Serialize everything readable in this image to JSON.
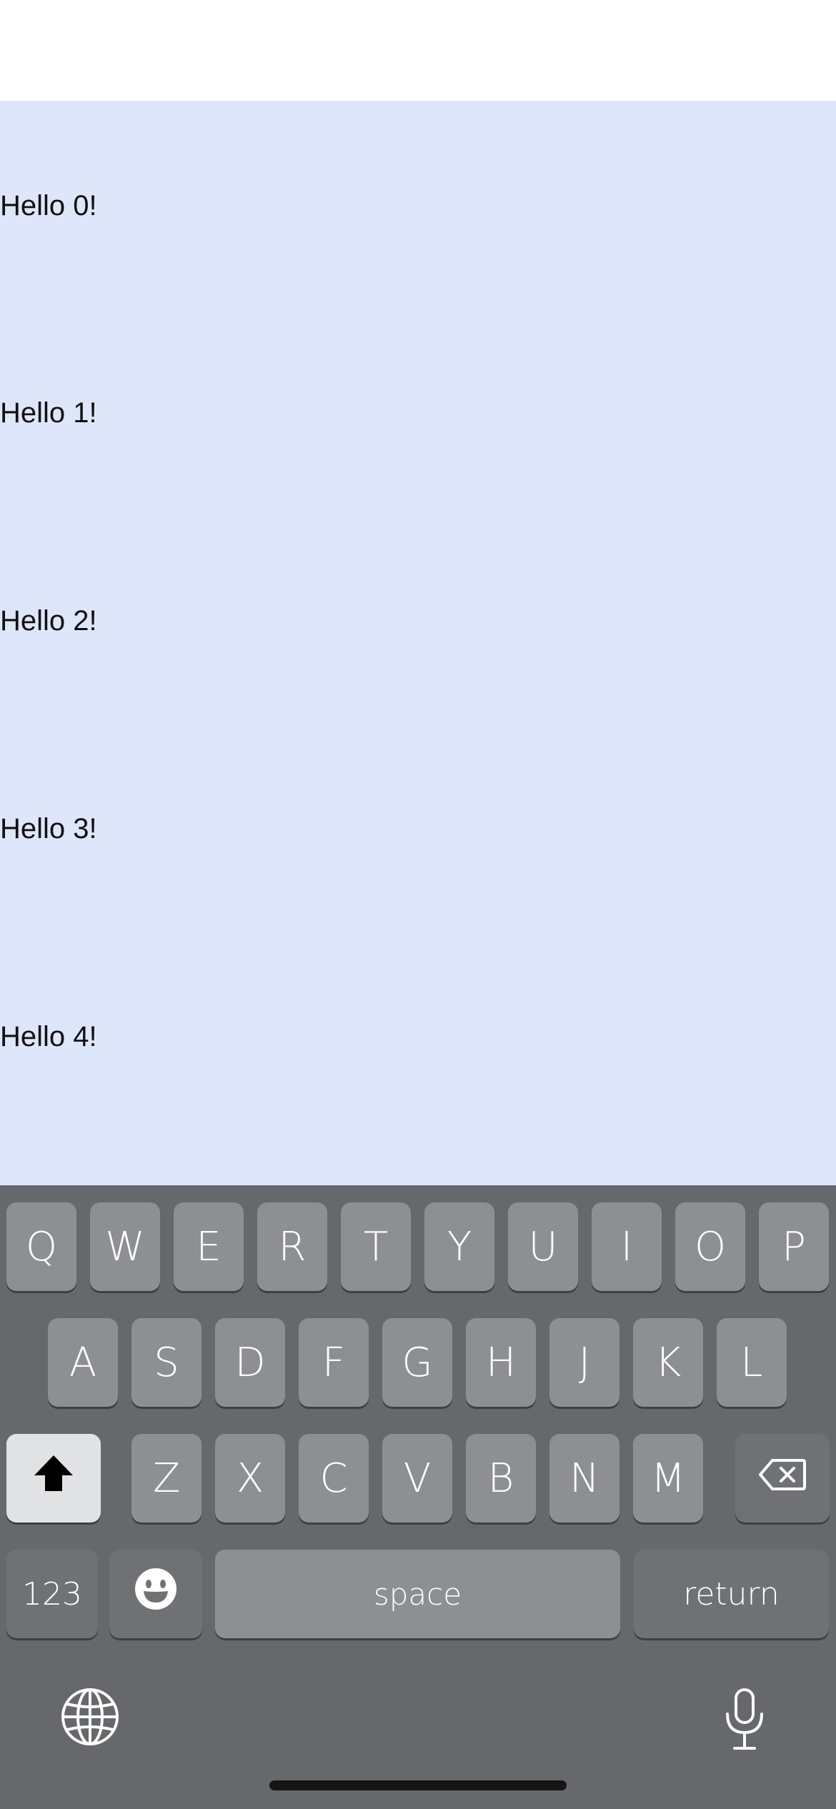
{
  "list": {
    "items": [
      "Hello 0!",
      "Hello 1!",
      "Hello 2!",
      "Hello 3!",
      "Hello 4!"
    ]
  },
  "keyboard": {
    "row1": [
      "Q",
      "W",
      "E",
      "R",
      "T",
      "Y",
      "U",
      "I",
      "O",
      "P"
    ],
    "row2": [
      "A",
      "S",
      "D",
      "F",
      "G",
      "H",
      "J",
      "K",
      "L"
    ],
    "row3": [
      "Z",
      "X",
      "C",
      "V",
      "B",
      "N",
      "M"
    ],
    "numbers_label": "123",
    "space_label": "space",
    "return_label": "return"
  },
  "icons": {
    "shift": "shift-icon",
    "delete": "backspace-icon",
    "emoji": "emoji-icon",
    "globe": "globe-icon",
    "mic": "microphone-icon"
  },
  "colors": {
    "content_bg": "#dde7f9",
    "keyboard_bg": "#67686b",
    "key_bg": "#8d8f93"
  }
}
